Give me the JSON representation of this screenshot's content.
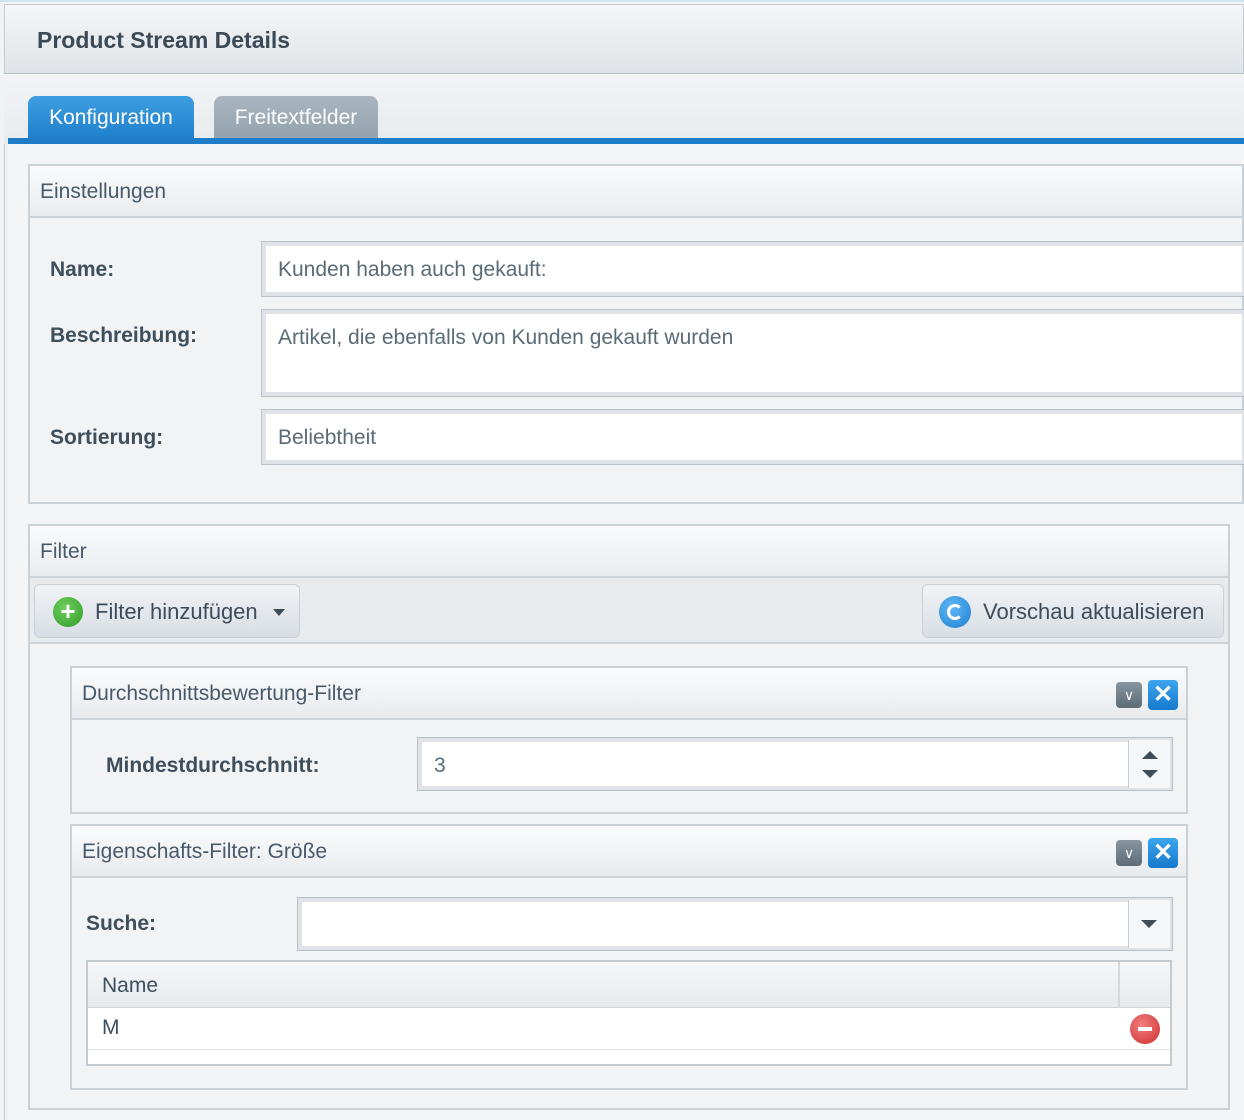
{
  "window": {
    "title": "Product Stream Details"
  },
  "tabs": [
    {
      "label": "Konfiguration",
      "active": true
    },
    {
      "label": "Freitextfelder",
      "active": false
    }
  ],
  "settings": {
    "title": "Einstellungen",
    "name_label": "Name:",
    "name_value": "Kunden haben auch gekauft:",
    "description_label": "Beschreibung:",
    "description_value": "Artikel, die ebenfalls von Kunden gekauft wurden",
    "sort_label": "Sortierung:",
    "sort_value": "Beliebtheit"
  },
  "filter": {
    "title": "Filter",
    "add_button": "Filter hinzufügen",
    "preview_button": "Vorschau aktualisieren",
    "rating_filter": {
      "title": "Durchschnittsbewertung-Filter",
      "min_label": "Mindestdurchschnitt:",
      "min_value": "3"
    },
    "property_filter": {
      "title": "Eigenschafts-Filter: Größe",
      "search_label": "Suche:",
      "search_value": "",
      "grid_header": "Name",
      "rows": [
        {
          "name": "M"
        }
      ]
    }
  },
  "icons": {
    "add": "plus-circle-icon",
    "dropdown": "caret-down-icon",
    "refresh": "refresh-icon",
    "collapse": "collapse-icon",
    "close": "close-icon",
    "delete": "minus-circle-icon"
  },
  "colors": {
    "accent": "#1e7cc9",
    "add_green": "#3aa534",
    "delete_red": "#d43a3a"
  }
}
